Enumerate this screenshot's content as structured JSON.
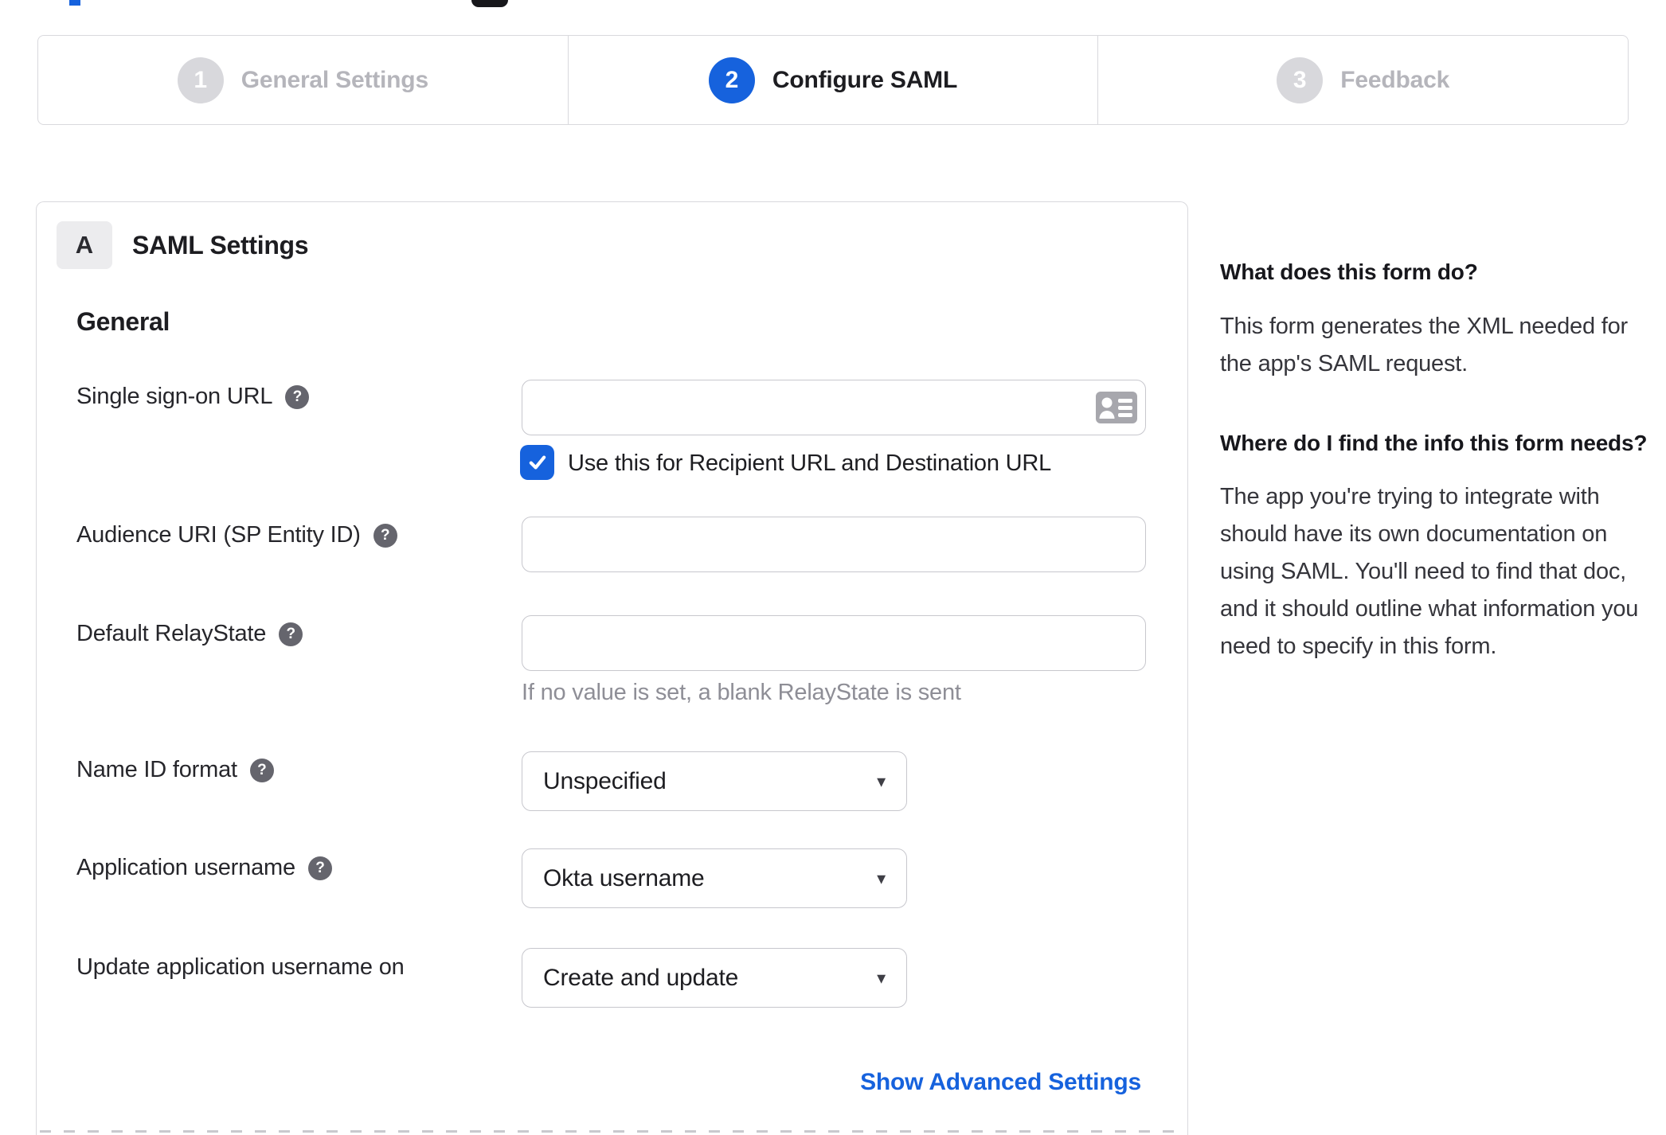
{
  "colors": {
    "accent_blue": "#1662dd",
    "inactive_gray": "#d8d8dc",
    "border_gray": "#d9d9dd",
    "hint_gray": "#8e8e96"
  },
  "icons": {
    "help_glyph": "?",
    "caret_glyph": "▾"
  },
  "stepper": {
    "steps": [
      {
        "number": "1",
        "label": "General Settings",
        "state": "inactive"
      },
      {
        "number": "2",
        "label": "Configure SAML",
        "state": "active"
      },
      {
        "number": "3",
        "label": "Feedback",
        "state": "inactive"
      }
    ]
  },
  "form_panel": {
    "badge": "A",
    "title": "SAML Settings",
    "section": "General",
    "sso": {
      "label": "Single sign-on URL",
      "value": "",
      "checkbox_label": "Use this for Recipient URL and Destination URL",
      "checkbox_checked": true
    },
    "audience": {
      "label": "Audience URI (SP Entity ID)",
      "value": ""
    },
    "relay": {
      "label": "Default RelayState",
      "value": "",
      "hint": "If no value is set, a blank RelayState is sent"
    },
    "name_id": {
      "label": "Name ID format",
      "value": "Unspecified"
    },
    "app_username": {
      "label": "Application username",
      "value": "Okta username"
    },
    "update_username": {
      "label": "Update application username on",
      "value": "Create and update"
    },
    "advanced_link": "Show Advanced Settings"
  },
  "help_sidebar": {
    "sections": [
      {
        "heading": "What does this form do?",
        "body": "This form generates the XML needed for the app's SAML request."
      },
      {
        "heading": "Where do I find the info this form needs?",
        "body": "The app you're trying to integrate with should have its own documentation on using SAML. You'll need to find that doc, and it should outline what information you need to specify in this form."
      }
    ]
  }
}
